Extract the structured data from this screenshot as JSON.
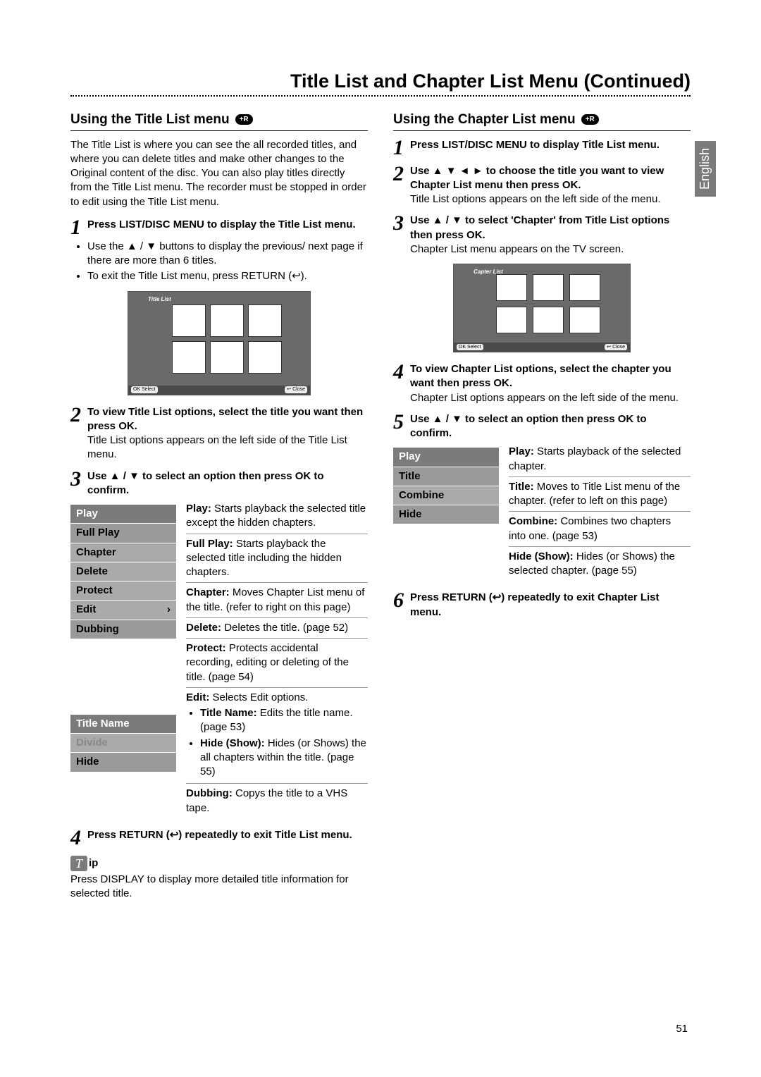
{
  "page_number": "51",
  "language_tab": "English",
  "main_title": "Title List and Chapter List Menu (Continued)",
  "left": {
    "heading": "Using the Title List menu",
    "badge": "+R",
    "intro": "The Title List is where you can see the all recorded titles, and where you can delete titles and make other changes to the Original content of the disc. You can also play titles directly from the Title List menu. The recorder must be stopped in order to edit using the Title List menu.",
    "step1_lead": "Press LIST/DISC MENU to display the Title List menu.",
    "step1_b1": "Use the ▲ / ▼ buttons to display the previous/ next page if there are more than 6 titles.",
    "step1_b2": "To exit the Title List menu, press RETURN (↩).",
    "thumb_label": "Title List",
    "thumb_close": "↩ Close",
    "thumb_select": "OK Select",
    "step2_lead": "To view Title List options, select the title you want then press OK.",
    "step2_text": "Title List options appears on the left side of the Title List menu.",
    "step3_lead": "Use ▲ / ▼ to select an option then press OK to confirm.",
    "menu1": [
      "Play",
      "Full Play",
      "Chapter",
      "Delete",
      "Protect",
      "Edit",
      "Dubbing"
    ],
    "menu1_chevron": "›",
    "defs": {
      "play": "Starts playback the selected title except the hidden chapters.",
      "fullplay": "Starts playback the selected title including the hidden chapters.",
      "chapter": "Moves Chapter List menu of the title. (refer to right on this page)",
      "delete": "Deletes the title. (page 52)",
      "protect": "Protects accidental recording, editing or deleting of the title. (page 54)",
      "edit": "Selects Edit options.",
      "edit_sub1_b": "Title Name:",
      "edit_sub1": " Edits the title name. (page 53)",
      "edit_sub2_b": "Hide (Show):",
      "edit_sub2": " Hides (or Shows) the all chapters within the title. (page 55)",
      "dubbing": "Copys the title to a VHS tape."
    },
    "menu2": [
      "Title Name",
      "Divide",
      "Hide"
    ],
    "step4_lead": "Press RETURN (↩) repeatedly to exit Title List menu.",
    "tip_label": "ip",
    "tip_icon": "T",
    "tip_text": "Press DISPLAY to display more detailed title information for selected title."
  },
  "right": {
    "heading": "Using the Chapter List menu",
    "badge": "+R",
    "step1_lead": "Press LIST/DISC MENU to display Title List menu.",
    "step2_lead": "Use ▲ ▼ ◄ ► to choose the title you want to view Chapter List menu then press OK.",
    "step2_text": "Title List options appears on the left side of the menu.",
    "step3_lead": "Use ▲ / ▼ to select 'Chapter' from Title List options then press OK.",
    "step3_text": "Chapter List menu appears on the TV screen.",
    "thumb_label": "Capter List",
    "thumb_close": "↩ Close",
    "thumb_select": "OK Select",
    "step4_lead": "To view Chapter List options, select the chapter you want then press OK.",
    "step4_text": "Chapter List options appears on the left side of the menu.",
    "step5_lead": "Use ▲ / ▼ to select an option then press OK to confirm.",
    "menu": [
      "Play",
      "Title",
      "Combine",
      "Hide"
    ],
    "defs": {
      "play": "Starts playback of the selected chapter.",
      "title": "Moves to Title List menu of the chapter. (refer to left on this page)",
      "combine": "Combines two chapters into one. (page 53)",
      "hide": "Hides (or Shows) the selected chapter. (page 55)"
    },
    "step6_lead": "Press RETURN (↩) repeatedly to exit Chapter List menu."
  }
}
